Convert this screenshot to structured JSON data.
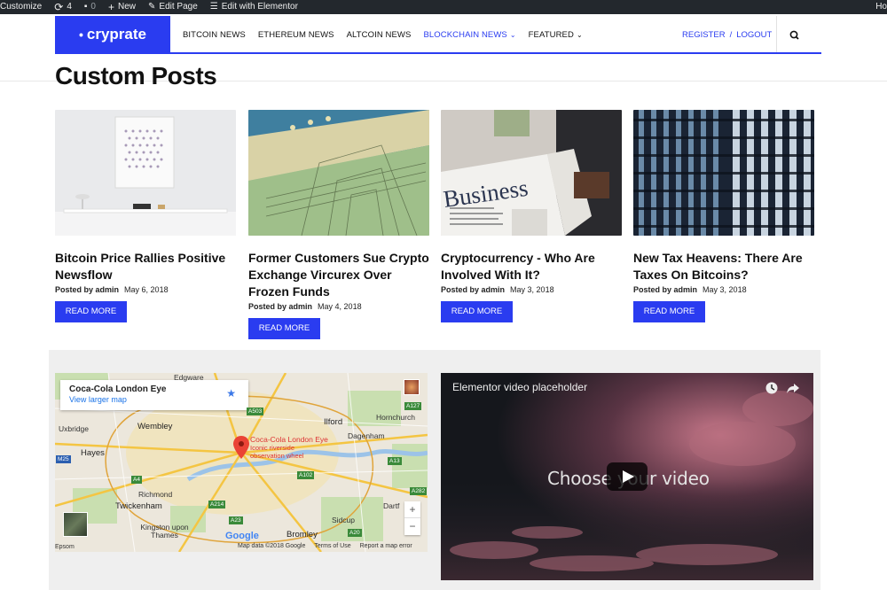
{
  "adminbar": {
    "customize": "Customize",
    "updates_count": "4",
    "comments_count": "0",
    "new_label": "New",
    "edit_page": "Edit Page",
    "edit_elementor": "Edit with Elementor",
    "right_partial": "Ho"
  },
  "header": {
    "logo": "cryprate",
    "nav": [
      {
        "label": "BITCOIN NEWS"
      },
      {
        "label": "ETHEREUM NEWS"
      },
      {
        "label": "ALTCOIN NEWS"
      },
      {
        "label": "BLOCKCHAIN NEWS"
      },
      {
        "label": "FEATURED"
      }
    ],
    "register": "REGISTER",
    "separator": "/",
    "logout": "LOGOUT"
  },
  "page": {
    "title": "Custom Posts"
  },
  "posts": [
    {
      "title": "Bitcoin Price Rallies Positive Newsflow",
      "posted_by": "Posted by",
      "author": "admin",
      "date": "May 6, 2018",
      "button": "READ MORE"
    },
    {
      "title": "Former Customers Sue Crypto Exchange Vircurex Over Frozen Funds",
      "posted_by": "Posted by",
      "author": "admin",
      "date": "May 4, 2018",
      "button": "READ MORE"
    },
    {
      "title": "Cryptocurrency - Who Are Involved With It?",
      "posted_by": "Posted by",
      "author": "admin",
      "date": "May 3, 2018",
      "button": "READ MORE"
    },
    {
      "title": "New Tax Heavens: There Are Taxes On Bitcoins?",
      "posted_by": "Posted by",
      "author": "admin",
      "date": "May 3, 2018",
      "button": "READ MORE"
    }
  ],
  "thumb_text": {
    "business": "Business"
  },
  "map": {
    "place": "Coca-Cola London Eye",
    "larger_map": "View larger map",
    "pin_title": "Coca-Cola London Eye",
    "pin_sub1": "Iconic riverside",
    "pin_sub2": "observation wheel",
    "labels": [
      "Edgware",
      "Ilford",
      "Hornchurch",
      "Uxbridge",
      "Wembley",
      "Dagenham",
      "Hayes",
      "Richmond",
      "Twickenham",
      "Kingston upon Thames",
      "Sidcup",
      "Dartf",
      "Bromley",
      "Epsom",
      "Hayes"
    ],
    "footer": {
      "data": "Map data ©2018 Google",
      "terms": "Terms of Use",
      "report": "Report a map error"
    },
    "google": "Google",
    "zoom_in": "+",
    "zoom_out": "−"
  },
  "video": {
    "title": "Elementor video placeholder",
    "headline": "Choose your video"
  }
}
